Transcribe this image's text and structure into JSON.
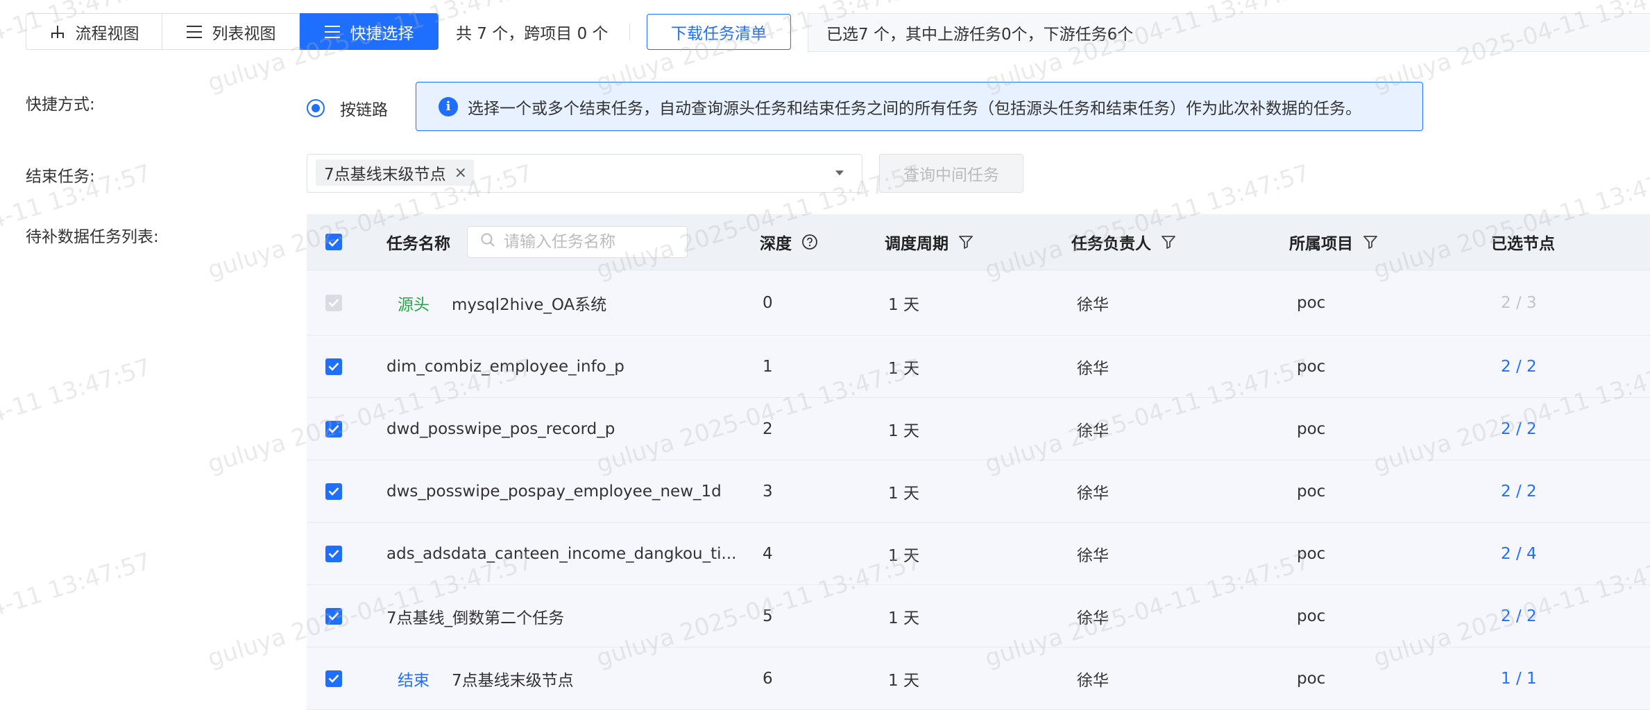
{
  "toolbar": {
    "view_tabs": [
      {
        "label": "流程视图",
        "icon": "flow-icon",
        "active": false
      },
      {
        "label": "列表视图",
        "icon": "list-icon",
        "active": false
      },
      {
        "label": "快捷选择",
        "icon": "list-icon",
        "active": true
      }
    ],
    "count_text": "共 7 个，跨项目 0 个",
    "download_label": "下载任务清单",
    "summary_text": "已选7 个，其中上游任务0个，下游任务6个"
  },
  "form": {
    "mode_label": "快捷方式:",
    "mode_option": "按链路",
    "info_text": "选择一个或多个结束任务，自动查询源头任务和结束任务之间的所有任务（包括源头任务和结束任务）作为此次补数据的任务。",
    "end_task_label": "结束任务:",
    "end_task_tag": "7点基线末级节点",
    "query_button": "查询中间任务",
    "list_label": "待补数据任务列表:"
  },
  "table": {
    "headers": {
      "name": "任务名称",
      "search_placeholder": "请输入任务名称",
      "depth": "深度",
      "cycle": "调度周期",
      "owner": "任务负责人",
      "project": "所属项目",
      "nodes": "已选节点"
    },
    "rows": [
      {
        "tag": "源头",
        "name": "mysql2hive_OA系统",
        "depth": "0",
        "cycle": "1 天",
        "owner": "徐华",
        "project": "poc",
        "nodes": "2 / 3",
        "checked": true,
        "disabled": true
      },
      {
        "tag": "",
        "name": "dim_combiz_employee_info_p",
        "depth": "1",
        "cycle": "1 天",
        "owner": "徐华",
        "project": "poc",
        "nodes": "2 / 2",
        "checked": true,
        "disabled": false
      },
      {
        "tag": "",
        "name": "dwd_posswipe_pos_record_p",
        "depth": "2",
        "cycle": "1 天",
        "owner": "徐华",
        "project": "poc",
        "nodes": "2 / 2",
        "checked": true,
        "disabled": false
      },
      {
        "tag": "",
        "name": "dws_posswipe_pospay_employee_new_1d",
        "depth": "3",
        "cycle": "1 天",
        "owner": "徐华",
        "project": "poc",
        "nodes": "2 / 2",
        "checked": true,
        "disabled": false
      },
      {
        "tag": "",
        "name": "ads_adsdata_canteen_income_dangkou_ti...",
        "depth": "4",
        "cycle": "1 天",
        "owner": "徐华",
        "project": "poc",
        "nodes": "2 / 4",
        "checked": true,
        "disabled": false
      },
      {
        "tag": "",
        "name": "7点基线_倒数第二个任务",
        "depth": "5",
        "cycle": "1 天",
        "owner": "徐华",
        "project": "poc",
        "nodes": "2 / 2",
        "checked": true,
        "disabled": false
      },
      {
        "tag": "结束",
        "name": "7点基线末级节点",
        "depth": "6",
        "cycle": "1 天",
        "owner": "徐华",
        "project": "poc",
        "nodes": "1 / 1",
        "checked": true,
        "disabled": false
      }
    ]
  },
  "watermark": "guluya 2025-04-11 13:47:57",
  "colors": {
    "primary": "#1f6fff",
    "source_tag": "#22a845",
    "row_bg": "#f5f7fc",
    "header_bg": "#eef1f6"
  }
}
